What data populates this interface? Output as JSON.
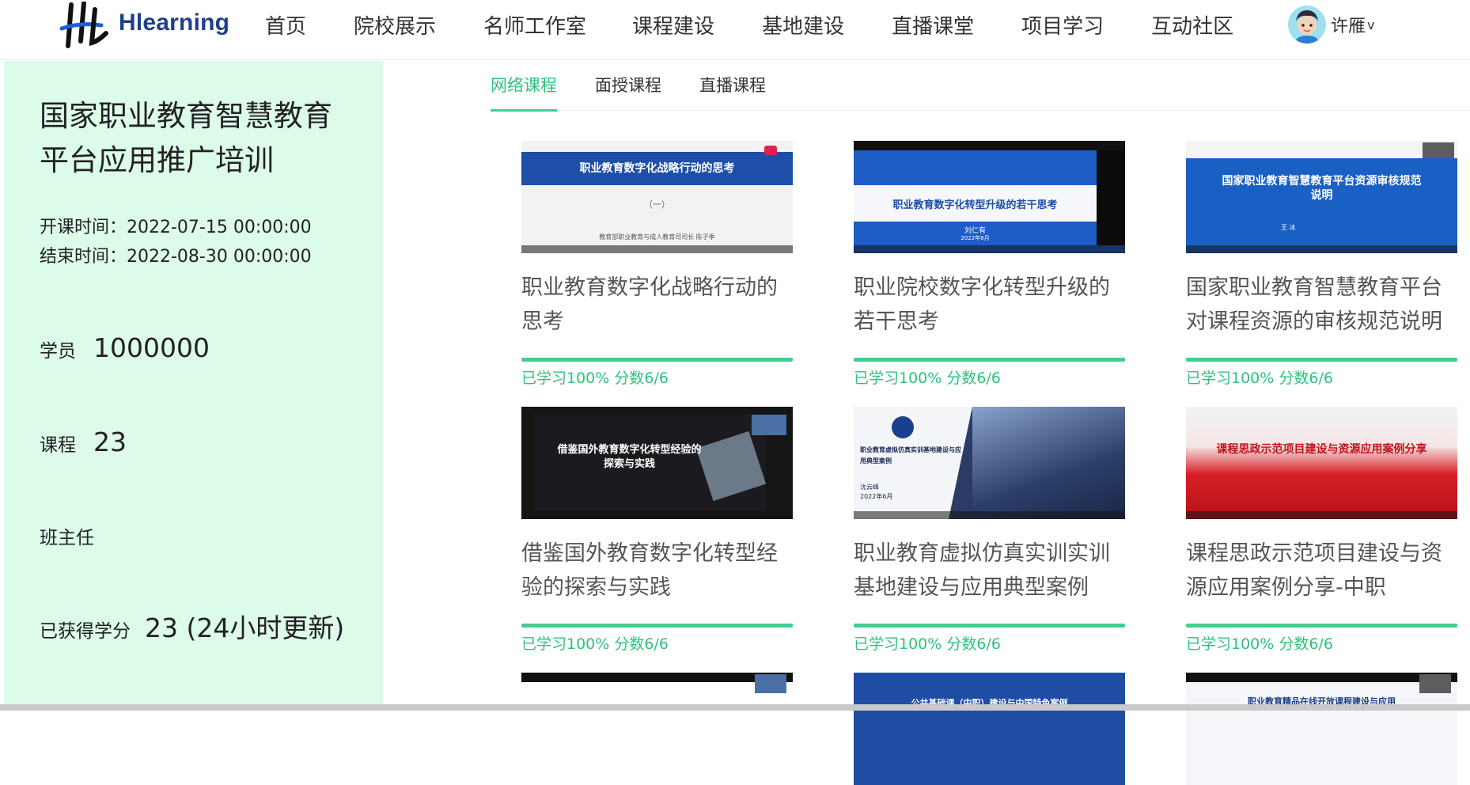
{
  "header": {
    "logo_text": "Hlearning",
    "nav": [
      "首页",
      "院校展示",
      "名师工作室",
      "课程建设",
      "基地建设",
      "直播课堂",
      "项目学习",
      "互动社区"
    ],
    "user_name": "许雁",
    "chevron": "v"
  },
  "sidebar": {
    "title": "国家职业教育智慧教育平台应用推广培训",
    "start_time": "开课时间：2022-07-15 00:00:00",
    "end_time": "结束时间：2022-08-30 00:00:00",
    "students_label": "学员",
    "students_value": "1000000",
    "courses_label": "课程",
    "courses_value": "23",
    "teacher_label": "班主任",
    "teacher_value": "",
    "credit_label": "已获得学分",
    "credit_value": "23 (24小时更新)"
  },
  "tabs": [
    "网络课程",
    "面授课程",
    "直播课程"
  ],
  "courses": [
    {
      "title": "职业教育数字化战略行动的思考",
      "progress": "已学习100% 分数6/6",
      "progress_fraction": 1.0,
      "thumb_text": "职业教育数字化战略行动的思考",
      "thumb_sub": "（一）",
      "thumb_caption": "教育部职业教育与成人教育司司长 陈子季"
    },
    {
      "title": "职业院校数字化转型升级的若干思考",
      "progress": "已学习100% 分数6/6",
      "progress_fraction": 1.0,
      "thumb_text": "职业教育数字化转型升级的若干思考",
      "thumb_sub": "刘仁有",
      "thumb_caption": "2022年8月"
    },
    {
      "title": "国家职业教育智慧教育平台对课程资源的审核规范说明",
      "progress": "已学习100% 分数6/6",
      "progress_fraction": 1.0,
      "thumb_text": "国家职业教育智慧教育平台资源审核规范说明",
      "thumb_sub": "",
      "thumb_caption": "王 冰"
    },
    {
      "title": "借鉴国外教育数字化转型经验的探索与实践",
      "progress": "已学习100% 分数6/6",
      "progress_fraction": 1.0,
      "thumb_text": "借鉴国外教育数字化转型经验的探索与实践",
      "thumb_sub": "",
      "thumb_caption": ""
    },
    {
      "title": "职业教育虚拟仿真实训实训基地建设与应用典型案例",
      "progress": "已学习100% 分数6/6",
      "progress_fraction": 1.0,
      "thumb_text": "职业教育虚拟仿真实训基地建设与应用典型案例",
      "thumb_sub": "沈云峰",
      "thumb_caption": "2022年6月"
    },
    {
      "title": "课程思政示范项目建设与资源应用案例分享-中职",
      "progress": "已学习100% 分数6/6",
      "progress_fraction": 1.0,
      "thumb_text": "课程思政示范项目建设与资源应用案例分享",
      "thumb_sub": "",
      "thumb_caption": ""
    },
    {
      "title": "",
      "progress": "",
      "progress_fraction": 1.0,
      "thumb_text": "",
      "thumb_sub": "",
      "thumb_caption": ""
    },
    {
      "title": "",
      "progress": "",
      "progress_fraction": 1.0,
      "thumb_text": "公共基础课（中职）建设与中国特色案例",
      "thumb_sub": "",
      "thumb_caption": ""
    },
    {
      "title": "",
      "progress": "",
      "progress_fraction": 1.0,
      "thumb_text": "职业教育精品在线开放课程建设与应用",
      "thumb_sub": "",
      "thumb_caption": ""
    }
  ],
  "colors": {
    "accent": "#2ec27e",
    "sidebar_bg": "#dcfbe9",
    "logo_blue": "#1f3e8c"
  }
}
